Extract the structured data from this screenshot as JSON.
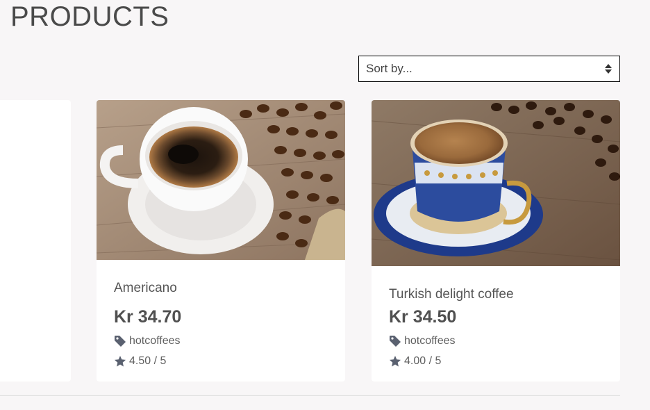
{
  "header": {
    "title": "PRODUCTS"
  },
  "sort": {
    "label": "Sort by..."
  },
  "products": [
    {
      "name": "Americano",
      "price": "Kr 34.70",
      "category": "hotcoffees",
      "rating": "4.50 / 5",
      "image": "americano-coffee-photo"
    },
    {
      "name": "Turkish delight coffee",
      "price": "Kr 34.50",
      "category": "hotcoffees",
      "rating": "4.00 / 5",
      "image": "turkish-coffee-photo"
    }
  ],
  "icons": {
    "category": "tag-icon",
    "rating": "star-icon",
    "sort": "sort-arrows-icon"
  },
  "colors": {
    "background": "#f8f6f7",
    "card": "#ffffff",
    "icon": "#5a6170",
    "text": "#555555"
  }
}
